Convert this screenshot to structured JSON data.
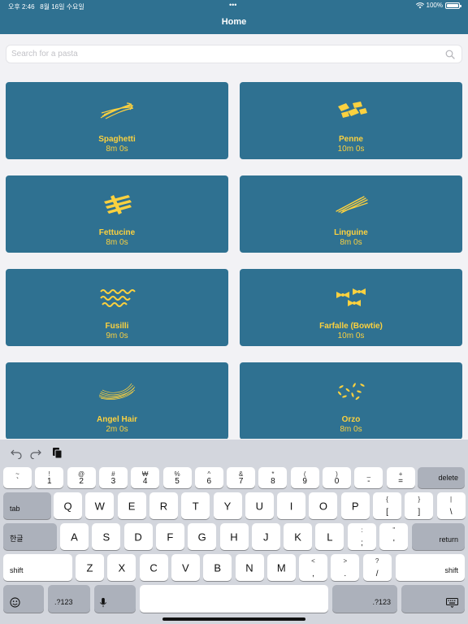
{
  "status": {
    "time": "오후 2:46",
    "date": "8월 16일 수요일",
    "dots": "•••",
    "battery": "100%",
    "battery_level": 1.0
  },
  "nav": {
    "title": "Home"
  },
  "search": {
    "placeholder": "Search for a pasta",
    "value": ""
  },
  "pastas": [
    {
      "name": "Spaghetti",
      "time": "8m 0s",
      "icon": "spaghetti-icon"
    },
    {
      "name": "Penne",
      "time": "10m 0s",
      "icon": "penne-icon"
    },
    {
      "name": "Fettucine",
      "time": "8m 0s",
      "icon": "fettucine-icon"
    },
    {
      "name": "Linguine",
      "time": "8m 0s",
      "icon": "linguine-icon"
    },
    {
      "name": "Fusilli",
      "time": "9m 0s",
      "icon": "fusilli-icon"
    },
    {
      "name": "Farfalle (Bowtie)",
      "time": "10m 0s",
      "icon": "farfalle-icon"
    },
    {
      "name": "Angel Hair",
      "time": "2m 0s",
      "icon": "angel-hair-icon"
    },
    {
      "name": "Orzo",
      "time": "8m 0s",
      "icon": "orzo-icon"
    }
  ],
  "keyboard": {
    "number_row": [
      {
        "top": "~",
        "bottom": "`"
      },
      {
        "top": "!",
        "bottom": "1"
      },
      {
        "top": "@",
        "bottom": "2"
      },
      {
        "top": "#",
        "bottom": "3"
      },
      {
        "top": "₩",
        "bottom": "4"
      },
      {
        "top": "%",
        "bottom": "5"
      },
      {
        "top": "^",
        "bottom": "6"
      },
      {
        "top": "&",
        "bottom": "7"
      },
      {
        "top": "*",
        "bottom": "8"
      },
      {
        "top": "(",
        "bottom": "9"
      },
      {
        "top": ")",
        "bottom": "0"
      },
      {
        "top": "_",
        "bottom": "-"
      },
      {
        "top": "+",
        "bottom": "="
      }
    ],
    "delete": "delete",
    "tab": "tab",
    "row2": [
      "Q",
      "W",
      "E",
      "R",
      "T",
      "Y",
      "U",
      "I",
      "O",
      "P"
    ],
    "row2_sym": [
      {
        "top": "{",
        "bottom": "["
      },
      {
        "top": "}",
        "bottom": "]"
      },
      {
        "top": "|",
        "bottom": "\\"
      }
    ],
    "hangul": "한글",
    "row3": [
      "A",
      "S",
      "D",
      "F",
      "G",
      "H",
      "J",
      "K",
      "L"
    ],
    "row3_sym": [
      {
        "top": ":",
        "bottom": ";"
      },
      {
        "top": "\"",
        "bottom": "'"
      }
    ],
    "return": "return",
    "shift": "shift",
    "row4": [
      "Z",
      "X",
      "C",
      "V",
      "B",
      "N",
      "M"
    ],
    "row4_sym": [
      {
        "top": "<",
        "bottom": ","
      },
      {
        "top": ">",
        "bottom": "."
      },
      {
        "top": "?",
        "bottom": "/"
      }
    ],
    "num_toggle": ".?123"
  },
  "colors": {
    "header": "#2f7191",
    "card": "#2f7191",
    "accent": "#fbd13f",
    "keyboard": "#d3d6dd"
  }
}
